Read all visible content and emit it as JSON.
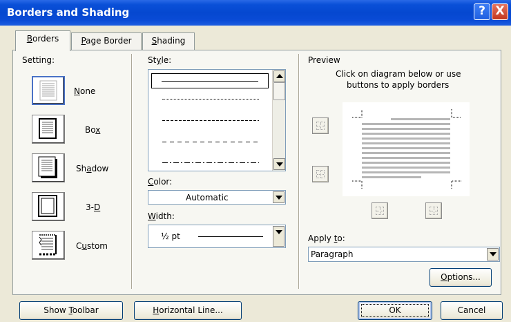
{
  "window": {
    "title": "Borders and Shading",
    "help_label": "?",
    "close_label": "X"
  },
  "tabs": [
    {
      "label": "Borders",
      "accel": "B",
      "rest": "orders"
    },
    {
      "label": "Page Border",
      "accel": "P",
      "rest": "age Border"
    },
    {
      "label": "Shading",
      "accel": "S",
      "rest": "hading"
    }
  ],
  "setting": {
    "label": "Setting:",
    "items": [
      {
        "pre": "",
        "accel": "N",
        "post": "one"
      },
      {
        "pre": "Bo",
        "accel": "x",
        "post": ""
      },
      {
        "pre": "Sh",
        "accel": "a",
        "post": "dow"
      },
      {
        "pre": "3-",
        "accel": "D",
        "post": ""
      },
      {
        "pre": "C",
        "accel": "u",
        "post": "stom"
      }
    ],
    "selected": "None"
  },
  "style": {
    "label_pre": "St",
    "label_accel": "y",
    "label_post": "le:",
    "options": [
      "solid",
      "dotted",
      "dashed-short",
      "dashed",
      "dash-dot"
    ]
  },
  "color": {
    "label_accel": "C",
    "label_post": "olor:",
    "value": "Automatic"
  },
  "width": {
    "label_accel": "W",
    "label_post": "idth:",
    "value": "½ pt"
  },
  "preview": {
    "label": "Preview",
    "hint_line1": "Click on diagram below or use",
    "hint_line2": "buttons to apply borders"
  },
  "apply_to": {
    "label_pre": "Apply ",
    "label_accel": "t",
    "label_post": "o:",
    "value": "Paragraph"
  },
  "buttons": {
    "options_accel": "O",
    "options_post": "ptions...",
    "toolbar_pre": "Show ",
    "toolbar_accel": "T",
    "toolbar_post": "oolbar",
    "hline_accel": "H",
    "hline_post": "orizontal Line...",
    "ok": "OK",
    "cancel": "Cancel"
  },
  "colors": {
    "title_bar": "#0548d0",
    "dialog_bg": "#ece9d8",
    "close_red": "#c2361d"
  }
}
